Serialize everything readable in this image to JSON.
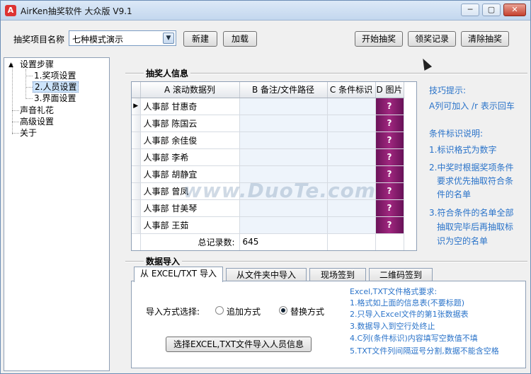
{
  "window": {
    "title": "AirKen抽奖软件 大众版 V9.1",
    "controls": [
      "─",
      "▢",
      "✕"
    ]
  },
  "toolbar": {
    "project_label": "抽奖项目名称",
    "project_value": "七种模式演示",
    "new_label": "新建",
    "load_label": "加载",
    "start_label": "开始抽奖",
    "records_label": "领奖记录",
    "clear_label": "清除抽奖"
  },
  "tree": {
    "root": "设置步骤",
    "children": [
      "1.奖项设置",
      "2.人员设置",
      "3.界面设置"
    ],
    "others": [
      "声音礼花",
      "高级设置",
      "关于"
    ]
  },
  "participants": {
    "section_title": "抽奖人信息",
    "columns": [
      "A 滚动数据列",
      "B 备注/文件路径",
      "C 条件标识",
      "D 图片"
    ],
    "rows": [
      "人事部 甘惠奇",
      "人事部 陈国云",
      "人事部 余佳俊",
      "人事部 李希",
      "人事部 胡静宜",
      "人事部 曾凤",
      "人事部 甘美琴",
      "人事部 王茹"
    ],
    "picture_glyph": "?",
    "total_label": "总记录数:",
    "total_value": "645"
  },
  "tips": {
    "heading": "技巧提示:",
    "line1": "A列可加入 /r 表示回车",
    "cond_heading": "条件标识说明:",
    "c1": "1.标识格式为数字",
    "c2a": "2.中奖时根据奖项条件",
    "c2b": "要求优先抽取符合条",
    "c2c": "件的名单",
    "c3a": "3.符合条件的名单全部",
    "c3b": "抽取完毕后再抽取标",
    "c3c": "识为空的名单"
  },
  "import": {
    "section_title": "数据导入",
    "tabs": [
      "从 EXCEL/TXT 导入",
      "从文件夹中导入",
      "现场签到",
      "二维码签到"
    ],
    "mode_label": "导入方式选择:",
    "opt_append": "追加方式",
    "opt_replace": "替换方式",
    "select_button": "选择EXCEL,TXT文件导入人员信息",
    "notes": [
      "Excel,TXT文件格式要求:",
      "1.格式如上面的信息表(不要标题)",
      "2.只导入Excel文件的第1张数据表",
      "3.数据导入到空行处终止",
      "4.C列(条件标识)内容填写空数值不填",
      "5.TXT文件列间隔逗号分割,数据不能含空格"
    ]
  },
  "watermark": "www.DuoTe.com",
  "colors": {
    "accent_text": "#2a73c9",
    "picture_cell": "#8b1c70"
  }
}
